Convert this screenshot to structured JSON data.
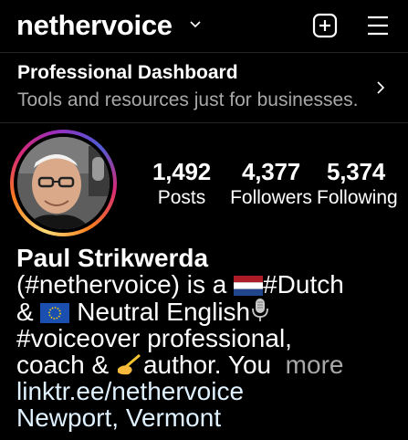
{
  "header": {
    "username": "nethervoice",
    "chevron_icon": "chevron-down-icon",
    "new_post_icon": "plus-square-icon",
    "menu_icon": "hamburger-menu-icon"
  },
  "dashboard": {
    "title": "Professional Dashboard",
    "subtitle": "Tools and resources just for businesses.",
    "chevron_icon": "chevron-right-icon"
  },
  "profile": {
    "avatar_icon": "profile-avatar",
    "ring_colors": [
      "#feda75",
      "#fa7e1e",
      "#d62976",
      "#962fbf",
      "#4f5bd5"
    ]
  },
  "stats": {
    "posts": {
      "value": "1,492",
      "label": "Posts"
    },
    "followers": {
      "value": "4,377",
      "label": "Followers"
    },
    "following": {
      "value": "5,374",
      "label": "Following"
    }
  },
  "bio": {
    "name": "Paul Strikwerda",
    "line1": "(#nethervoice) is a ",
    "line1_tail": "#Dutch",
    "line2_a": "& ",
    "line2_b": "Neutral English",
    "line3": "#voiceover professional,",
    "line4_a": "coach & ",
    "line4_b": "author. You",
    "more": "more",
    "link": "linktr.ee/nethervoice",
    "location": "Newport, Vermont"
  }
}
